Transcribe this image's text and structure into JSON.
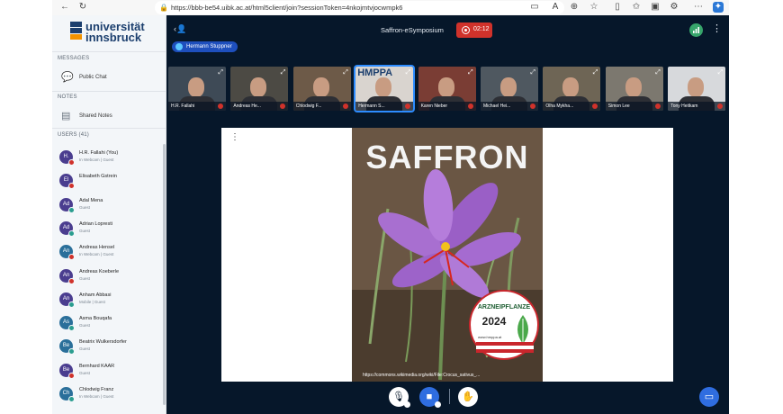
{
  "browser": {
    "url": "https://bbb-be54.uibk.ac.at/html5client/join?sessionToken=4nkojmtvjocwmpk6"
  },
  "sidebar": {
    "logo_line1": "universität",
    "logo_line2": "innsbruck",
    "messages_header": "MESSAGES",
    "public_chat": "Public Chat",
    "notes_header": "NOTES",
    "shared_notes": "Shared Notes",
    "users_header": "USERS (41)",
    "users": [
      {
        "initials": "H.",
        "name": "H.R. Fallahi (You)",
        "status": "In Webcam | Guest",
        "color": "#4a3d8f",
        "badge": "#d0322b"
      },
      {
        "initials": "El",
        "name": "Elisabeth Gstrein",
        "status": "",
        "color": "#4a3d8f",
        "badge": "#d0322b"
      },
      {
        "initials": "Ad",
        "name": "Adal Mena",
        "status": "Guest",
        "color": "#4a3d8f",
        "badge": "#2a9d8f"
      },
      {
        "initials": "Ad",
        "name": "Adrian Lopresti",
        "status": "Guest",
        "color": "#4a3d8f",
        "badge": "#2a9d8f"
      },
      {
        "initials": "An",
        "name": "Andreas Hensel",
        "status": "In Webcam | Guest",
        "color": "#2a6f9a",
        "badge": "#d0322b"
      },
      {
        "initials": "An",
        "name": "Andreas Koeberle",
        "status": "Guest",
        "color": "#4a3d8f",
        "badge": "#d0322b"
      },
      {
        "initials": "An",
        "name": "Anham Abbasi",
        "status": "Mobile | Guest",
        "color": "#4a3d8f",
        "badge": "#2a9d8f"
      },
      {
        "initials": "As",
        "name": "Asma Bouqafa",
        "status": "Guest",
        "color": "#2a6f9a",
        "badge": "#2a9d8f"
      },
      {
        "initials": "Be",
        "name": "Beatrix Wulkersdorfer",
        "status": "Guest",
        "color": "#2a6f9a",
        "badge": "#2a9d8f"
      },
      {
        "initials": "Be",
        "name": "Bernhard KAAR",
        "status": "Guest",
        "color": "#4a3d8f",
        "badge": "#d0322b"
      },
      {
        "initials": "Ch",
        "name": "Chlodwig Franz",
        "status": "In Webcam | Guest",
        "color": "#2a6f9a",
        "badge": "#2a9d8f"
      }
    ]
  },
  "meeting": {
    "title": "Saffron-eSymposium",
    "timer": "02:12",
    "presenter": "Hermann Stuppner"
  },
  "webcams": [
    {
      "name": "H.R. Fallahi",
      "bg": "#3e4a56"
    },
    {
      "name": "Andreas He...",
      "bg": "#4c4a44"
    },
    {
      "name": "Chlodwig F...",
      "bg": "#6d5a48"
    },
    {
      "name": "Hermann S...",
      "bg": "#d9d4cf",
      "active": true
    },
    {
      "name": "Karen Nieber",
      "bg": "#7a3d34"
    },
    {
      "name": "Michael Hei...",
      "bg": "#4f5860"
    },
    {
      "name": "Olha Mykha...",
      "bg": "#6e6555"
    },
    {
      "name": "Simon Lee",
      "bg": "#7c786f"
    },
    {
      "name": "Tony Heitkam",
      "bg": "#d7d9dc"
    }
  ],
  "hmppa_label": "HMPPA",
  "slide": {
    "title": "SAFFRON",
    "badge_top": "ARZNEIPFLANZE",
    "badge_year": "2024",
    "badge_site": "www.hmppa.at",
    "credit": "https://commons.wikimedia.org/wiki/File:Crocus_sativus_..."
  }
}
